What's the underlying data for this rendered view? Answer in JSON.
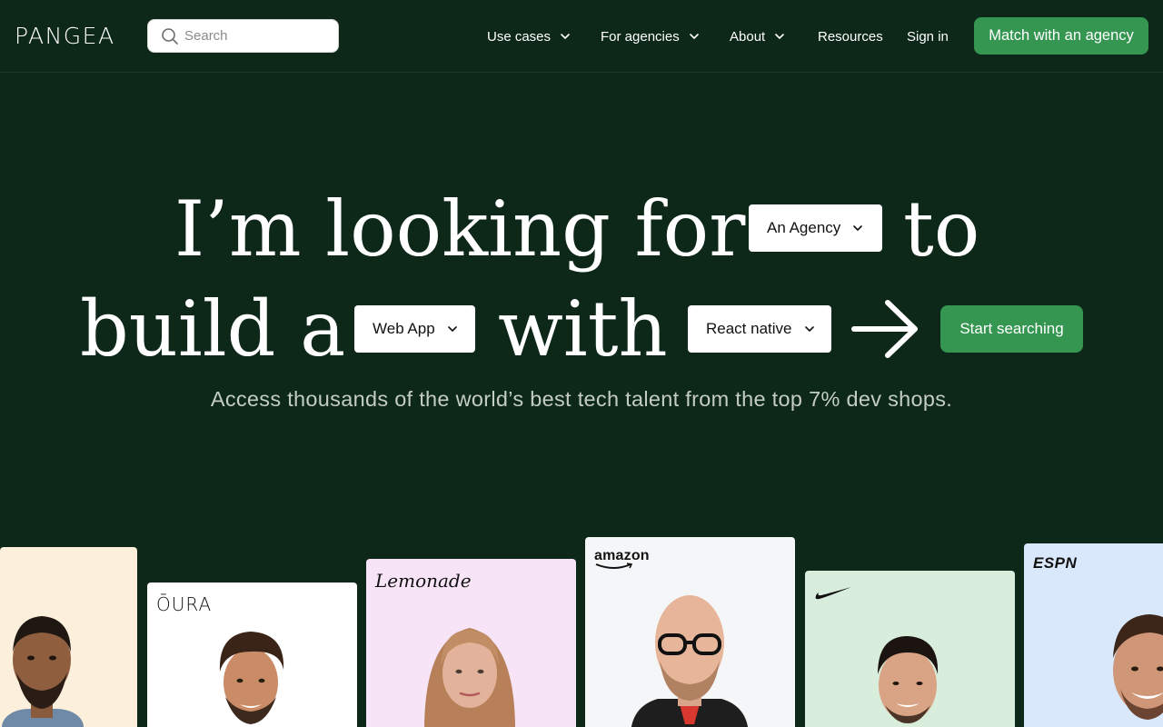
{
  "header": {
    "logo": "PANGEA",
    "search_placeholder": "Search",
    "nav": {
      "use_cases": "Use cases",
      "for_agencies": "For agencies",
      "about": "About",
      "resources": "Resources",
      "sign_in": "Sign in"
    },
    "cta": "Match with an agency"
  },
  "hero": {
    "line1_a": "I’m looking for",
    "line1_b": "to",
    "line2_a": "build a",
    "line2_b": "with",
    "dropdown_looking": "An Agency",
    "dropdown_build": "Web App",
    "dropdown_tech": "React native",
    "cta": "Start searching",
    "subtitle": "Access thousands of the world’s best tech talent from the top 7% dev shops."
  },
  "cards": {
    "oura": "ŌURA",
    "lemonade": "Lemonade",
    "amazon": "amazon",
    "espn": "ESPN"
  },
  "icons": {
    "search": "search-icon",
    "chevron": "chevron-down-icon",
    "arrow": "arrow-right-icon",
    "nike": "nike-swoosh-logo"
  },
  "colors": {
    "background": "#0d2819",
    "accent_green": "#349651",
    "card_peach": "#fcefdc",
    "card_white": "#ffffff",
    "card_pink": "#f7e4f6",
    "card_grey": "#f5f6f7",
    "card_mint": "#d8eddc",
    "card_blue": "#d9e9fb"
  }
}
